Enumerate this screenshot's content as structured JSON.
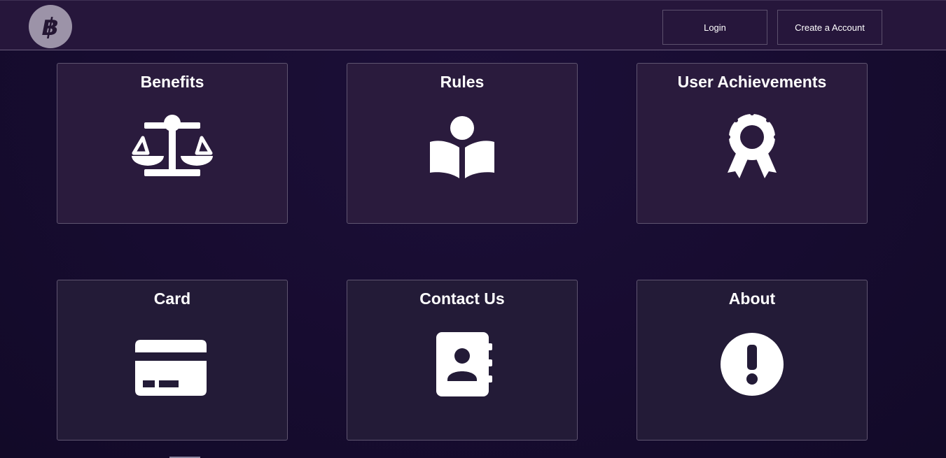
{
  "header": {
    "logo_icon": "bitcoin-icon",
    "login_label": "Login",
    "signup_label": "Create a Account"
  },
  "cards": [
    {
      "title": "Benefits",
      "icon": "scale-balance-icon"
    },
    {
      "title": "Rules",
      "icon": "book-reader-icon"
    },
    {
      "title": "User Achievements",
      "icon": "award-ribbon-icon"
    },
    {
      "title": "Card",
      "icon": "credit-card-icon"
    },
    {
      "title": "Contact Us",
      "icon": "address-book-icon"
    },
    {
      "title": "About",
      "icon": "exclamation-circle-icon"
    }
  ],
  "colors": {
    "background": "#170c30",
    "header": "#26163b",
    "card": "#2a1b3d",
    "text": "#ffffff"
  }
}
